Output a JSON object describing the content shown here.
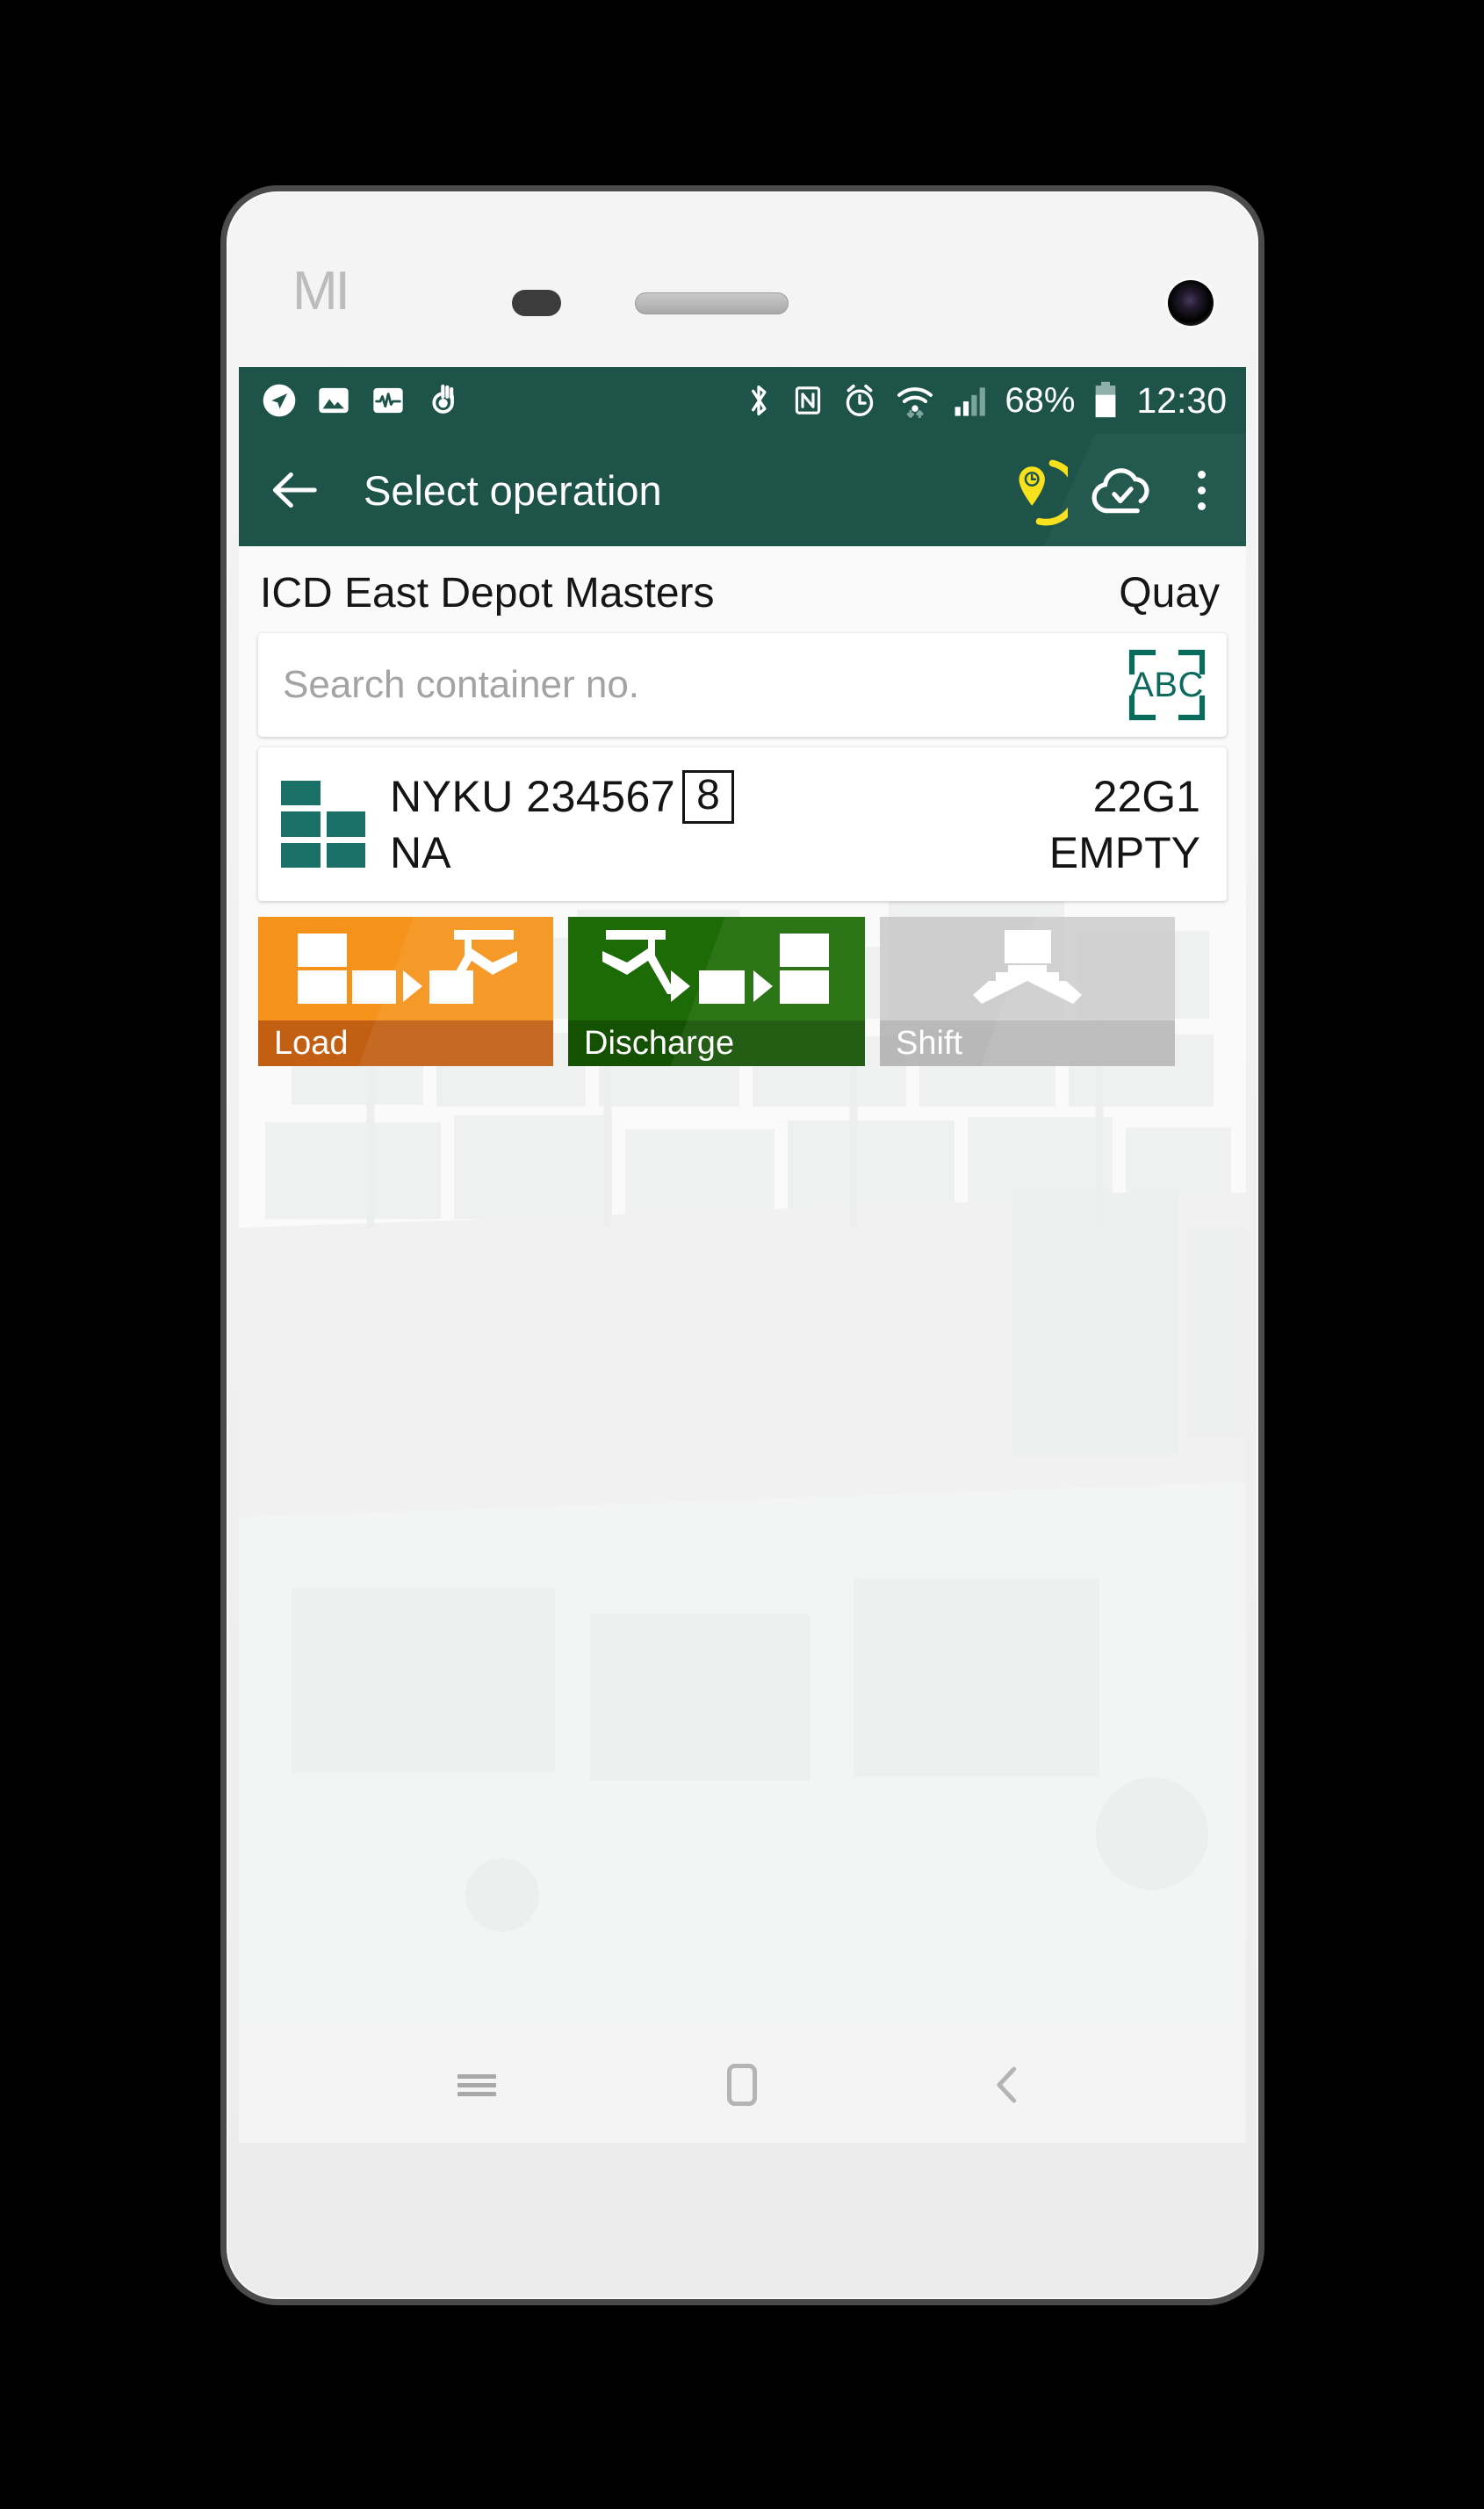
{
  "device": {
    "brand_logo": "MI",
    "sensor": "proximity-sensor",
    "speaker": "earpiece-speaker",
    "camera": "front-camera"
  },
  "status_bar": {
    "background": "#1d5349",
    "left_icons": [
      "navigation-arrow-icon",
      "photo-icon",
      "activity-monitor-icon",
      "gesture-hand-icon"
    ],
    "right_icons": [
      "bluetooth-icon",
      "nfc-icon",
      "alarm-icon",
      "wifi-icon",
      "signal-icon",
      "battery-icon"
    ],
    "battery_percent": "68%",
    "clock": "12:30"
  },
  "app_bar": {
    "background": "#1d5349",
    "back_label": "back-arrow",
    "title": "Select operation",
    "actions": [
      {
        "name": "gps-location-icon",
        "color": "#f5e11a"
      },
      {
        "name": "cloud-sync-icon",
        "color": "#ffffff"
      },
      {
        "name": "overflow-menu-icon",
        "color": "#ffffff"
      }
    ]
  },
  "header": {
    "depot_name": "ICD East Depot Masters",
    "location": "Quay"
  },
  "search": {
    "placeholder": "Search container no.",
    "value": "",
    "scan_button_label": "ABC",
    "scan_accent": "#0c6b5c"
  },
  "container": {
    "icon": "container-stack-icon",
    "number": "NYKU 234567",
    "check_digit": "8",
    "status_left": "NA",
    "type_code": "22G1",
    "state": "EMPTY"
  },
  "operations": [
    {
      "id": "load",
      "label": "Load",
      "art_color": "#f59219",
      "label_color": "#c25f13",
      "icon": "load-to-ship-icon",
      "enabled": true
    },
    {
      "id": "discharge",
      "label": "Discharge",
      "art_color": "#1c6b06",
      "label_color": "#145103",
      "icon": "discharge-from-ship-icon",
      "enabled": true
    },
    {
      "id": "shift",
      "label": "Shift",
      "art_color": "#c6c6c6",
      "label_color": "#aaaaaa",
      "icon": "shift-on-ship-icon",
      "enabled": false
    }
  ],
  "nav_bar": {
    "buttons": [
      "recents-icon",
      "home-icon",
      "back-icon"
    ]
  }
}
